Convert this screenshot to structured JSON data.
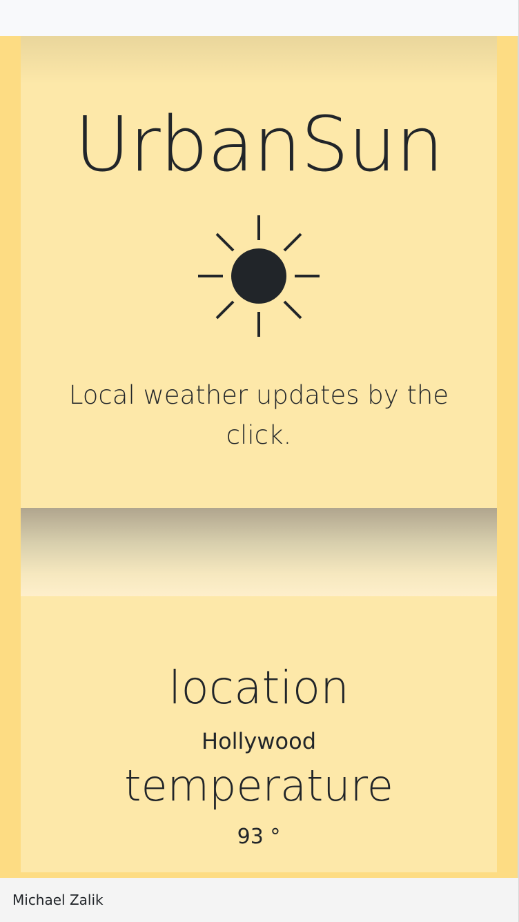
{
  "header": {
    "title": "UrbanSun",
    "tagline": "Local weather updates by the click.",
    "icon": "sun-icon"
  },
  "weather": {
    "location_label": "location",
    "location_value": "Hollywood",
    "temperature_label": "temperature",
    "temperature_value": "93 °"
  },
  "footer": {
    "author": "Michael Zalik"
  },
  "colors": {
    "page_bg": "#fddc83",
    "panel_bg": "#fde8a9",
    "text": "#212529"
  }
}
